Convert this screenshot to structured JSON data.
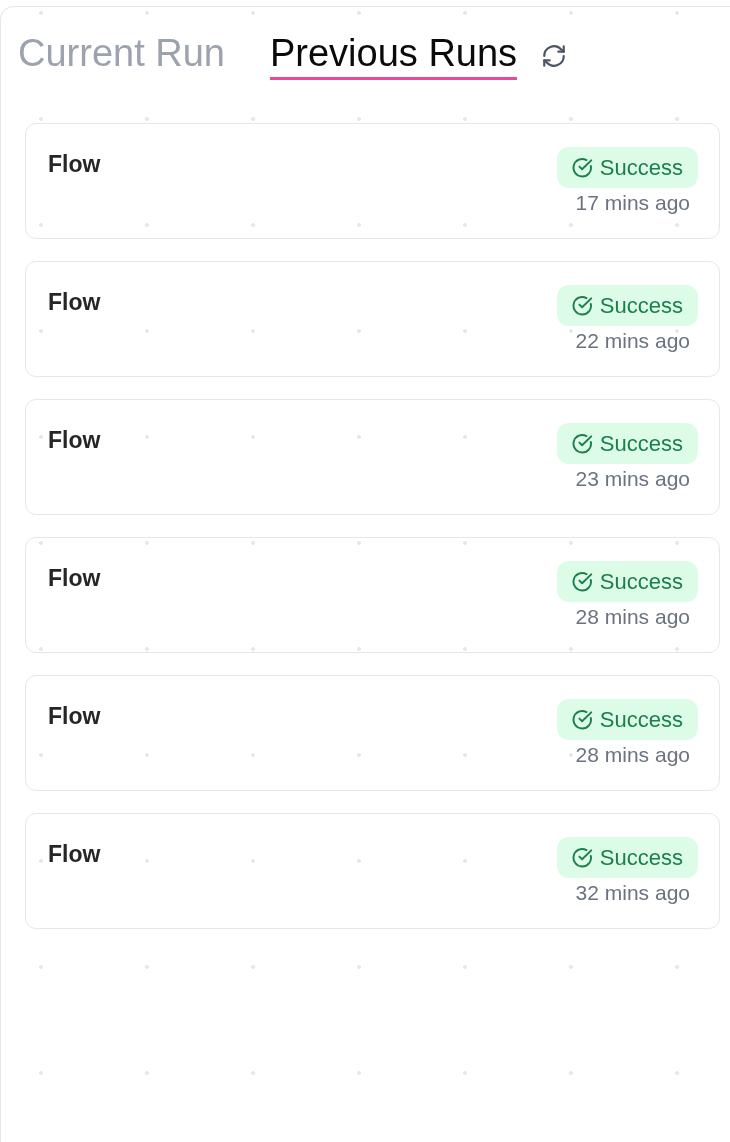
{
  "tabs": [
    {
      "label": "Current Run",
      "selected": false
    },
    {
      "label": "Previous Runs",
      "selected": true
    }
  ],
  "runs": [
    {
      "name": "Flow",
      "status": {
        "kind": "success",
        "label": "Success"
      },
      "time": "17 mins ago"
    },
    {
      "name": "Flow",
      "status": {
        "kind": "success",
        "label": "Success"
      },
      "time": "22 mins ago"
    },
    {
      "name": "Flow",
      "status": {
        "kind": "success",
        "label": "Success"
      },
      "time": "23 mins ago"
    },
    {
      "name": "Flow",
      "status": {
        "kind": "success",
        "label": "Success"
      },
      "time": "28 mins ago"
    },
    {
      "name": "Flow",
      "status": {
        "kind": "success",
        "label": "Success"
      },
      "time": "28 mins ago"
    },
    {
      "name": "Flow",
      "status": {
        "kind": "success",
        "label": "Success"
      },
      "time": "32 mins ago"
    }
  ]
}
